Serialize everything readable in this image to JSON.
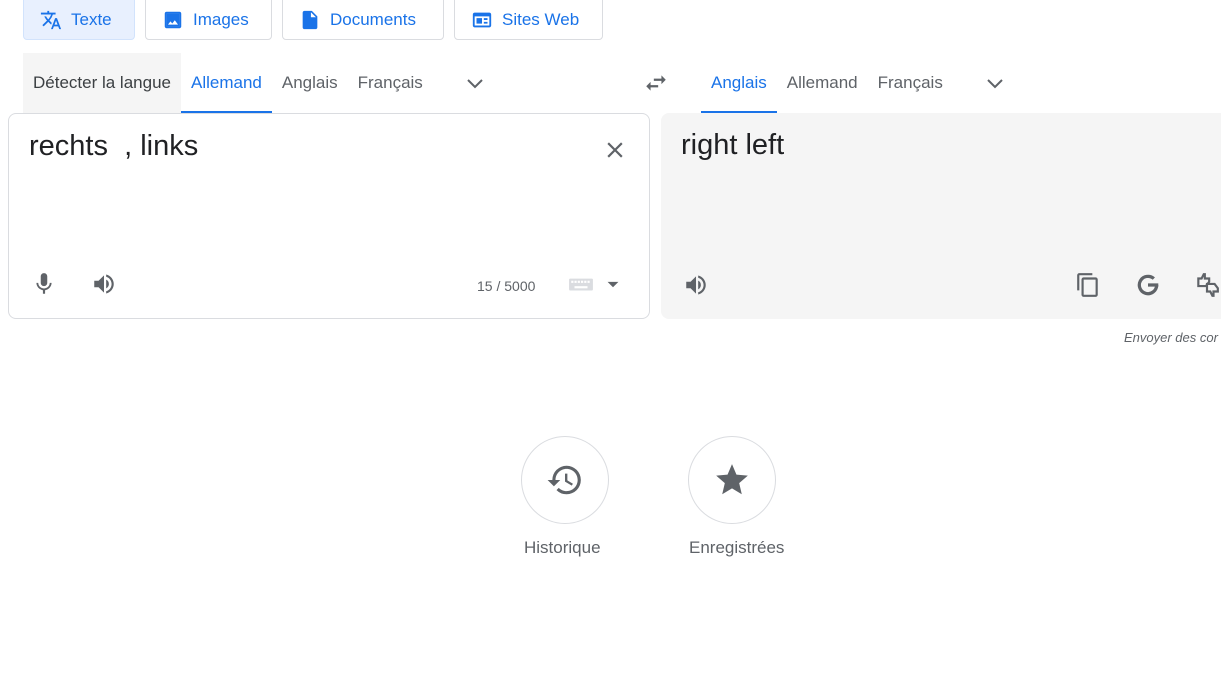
{
  "modes": [
    {
      "label": "Texte",
      "icon": "translate-icon",
      "active": true
    },
    {
      "label": "Images",
      "icon": "image-icon"
    },
    {
      "label": "Documents",
      "icon": "document-icon"
    },
    {
      "label": "Sites Web",
      "icon": "web-icon"
    }
  ],
  "source_langs": {
    "detect": "Détecter la langue",
    "items": [
      "Allemand",
      "Anglais",
      "Français"
    ],
    "active": "Allemand"
  },
  "target_langs": {
    "items": [
      "Anglais",
      "Allemand",
      "Français"
    ],
    "active": "Anglais"
  },
  "source": {
    "text": "rechts  , links",
    "char_count": "15 / 5000"
  },
  "target": {
    "text": "right left",
    "feedback": "Envoyer des cor"
  },
  "bottom": {
    "history_label": "Historique",
    "saved_label": "Enregistrées"
  },
  "colors": {
    "accent": "#1a73e8",
    "active_mode_bg": "#e8f0fe",
    "target_panel_bg": "#f5f5f5"
  }
}
